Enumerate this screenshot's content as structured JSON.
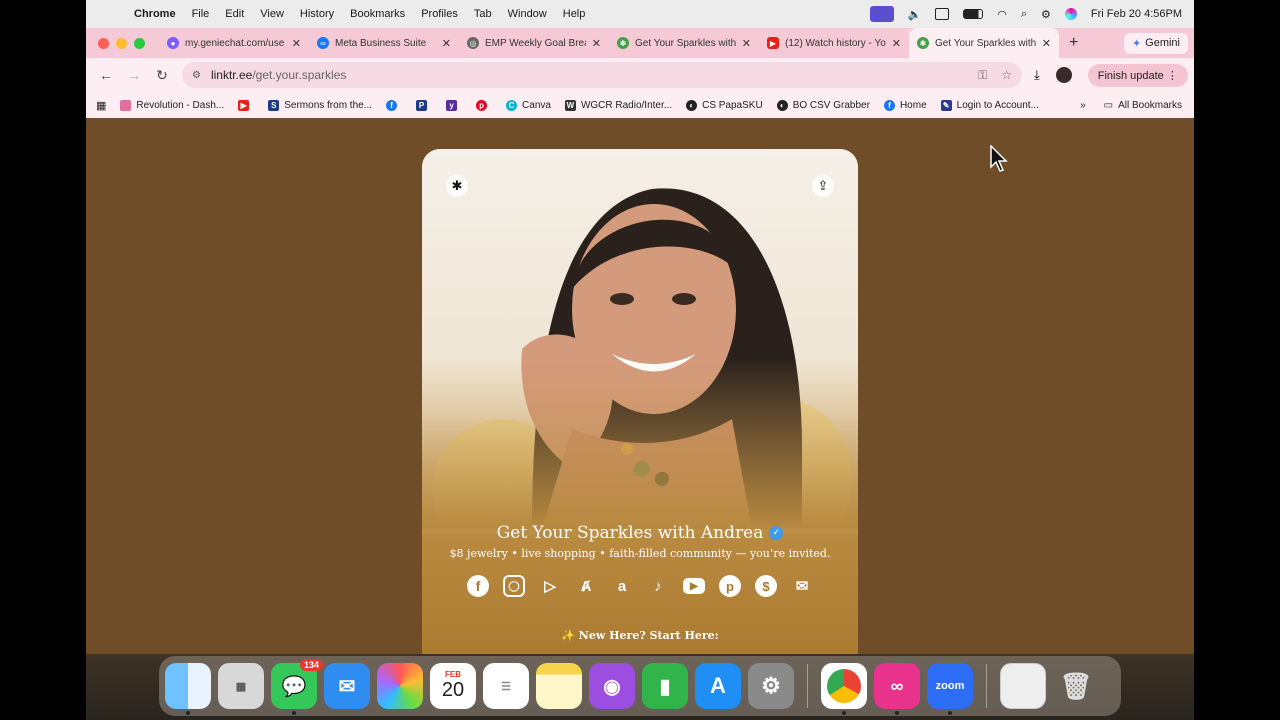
{
  "menubar": {
    "app": "Chrome",
    "items": [
      "File",
      "Edit",
      "View",
      "History",
      "Bookmarks",
      "Profiles",
      "Tab",
      "Window",
      "Help"
    ],
    "clock": "Fri Feb 20  4:56PM"
  },
  "tabs": [
    {
      "title": "my.geniechat.com/use",
      "color": "#7b5cff",
      "active": false
    },
    {
      "title": "Meta Business Suite",
      "color": "#1877f2",
      "active": false
    },
    {
      "title": "EMP Weekly Goal Brea",
      "color": "#666666",
      "active": false
    },
    {
      "title": "Get Your Sparkles with",
      "color": "#43a047",
      "active": false
    },
    {
      "title": "(12) Watch history - Yo",
      "color": "#e62117",
      "active": false
    },
    {
      "title": "Get Your Sparkles with",
      "color": "#43a047",
      "active": true
    }
  ],
  "gemini_label": "Gemini",
  "omnibox": {
    "domain": "linktr.ee",
    "path": "/get.your.sparkles"
  },
  "finish_update": "Finish update",
  "bookmarks": [
    {
      "label": "Revolution - Dash...",
      "color": "#e36fa0"
    },
    {
      "label": "",
      "color": "#e62117"
    },
    {
      "label": "Sermons from the...",
      "color": "#1b3c8a"
    },
    {
      "label": "",
      "color": "#1877f2"
    },
    {
      "label": "",
      "color": "#1e3a8a"
    },
    {
      "label": "",
      "color": "#5b2b9c"
    },
    {
      "label": "",
      "color": "#e60023"
    },
    {
      "label": "Canva",
      "color": "#00b4d8"
    },
    {
      "label": "WGCR Radio/Inter...",
      "color": "#333333"
    },
    {
      "label": "CS PapaSKU",
      "color": "#222222"
    },
    {
      "label": "BO CSV Grabber",
      "color": "#222222"
    },
    {
      "label": "Home",
      "color": "#1877f2"
    },
    {
      "label": "Login to Account...",
      "color": "#2b3a8c"
    }
  ],
  "all_bookmarks": "All Bookmarks",
  "profile": {
    "name": "Get Your Sparkles with Andrea",
    "bio": "$8 jewelry • live shopping • faith-filled community — you’re invited.",
    "section": "✨ New Here? Start Here:",
    "socials": [
      "facebook-icon",
      "instagram-icon",
      "google-play-icon",
      "app-store-icon",
      "amazon-icon",
      "tiktok-icon",
      "youtube-icon",
      "pinterest-icon",
      "cash-app-icon",
      "email-icon"
    ]
  },
  "dock": {
    "messages_badge": "134",
    "calendar_month": "FEB",
    "calendar_day": "20",
    "zoom_label": "zoom"
  }
}
